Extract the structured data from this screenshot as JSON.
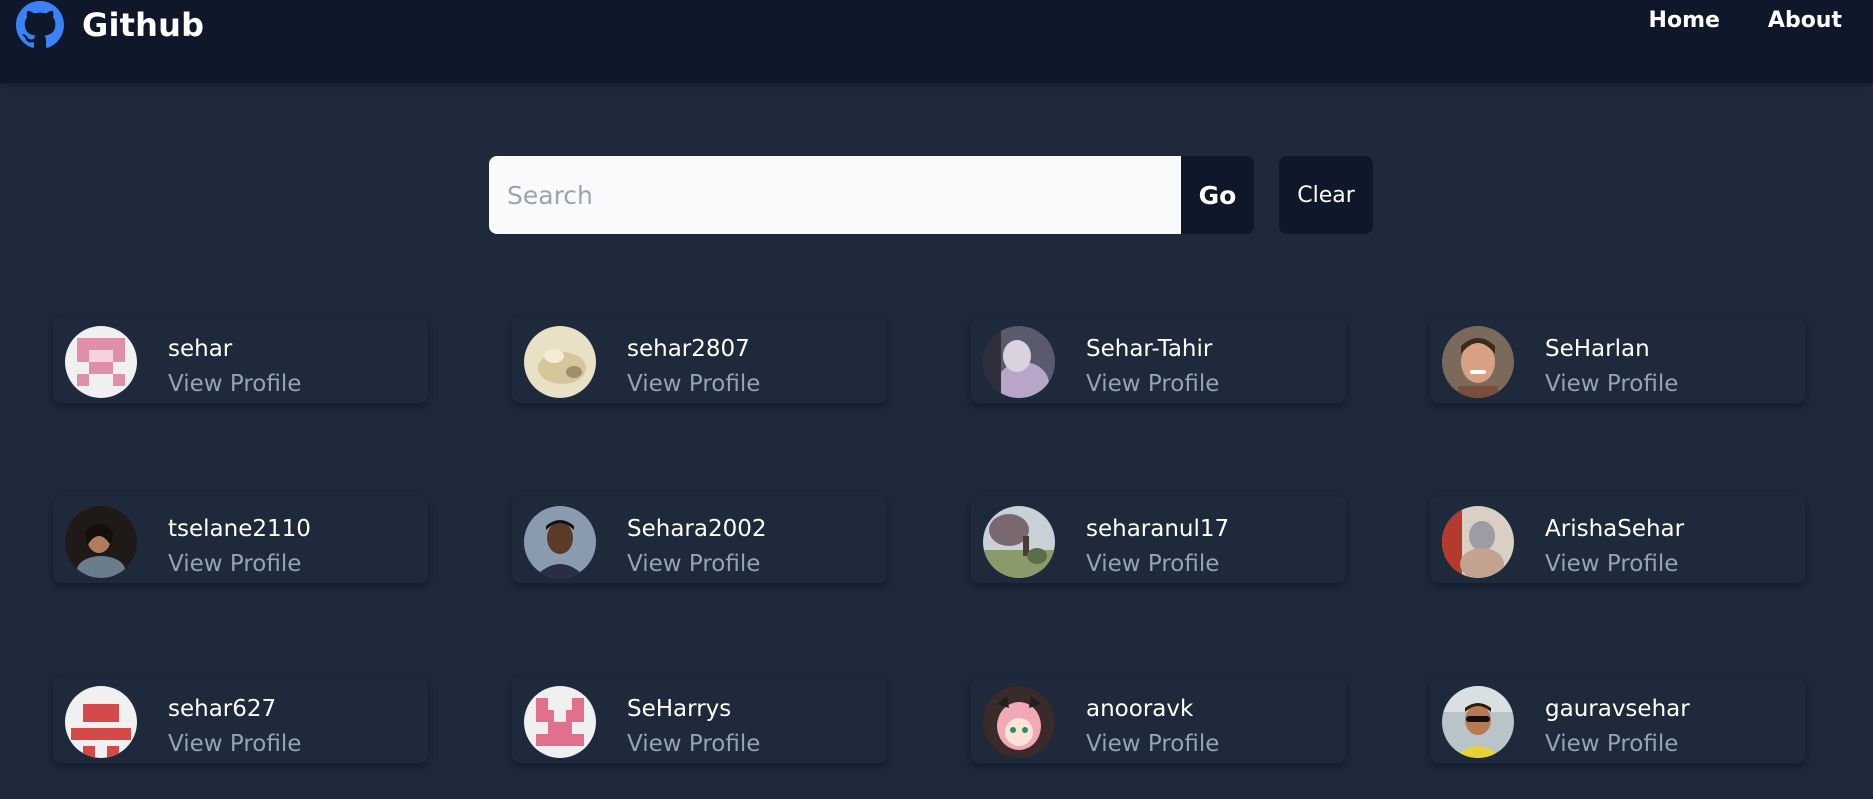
{
  "navbar": {
    "brand": "Github",
    "links": [
      {
        "label": "Home"
      },
      {
        "label": "About"
      }
    ]
  },
  "search": {
    "placeholder": "Search",
    "value": "",
    "go_label": "Go",
    "clear_label": "Clear"
  },
  "users": [
    {
      "login": "sehar",
      "link": "View Profile",
      "avatar": "identicon-pink"
    },
    {
      "login": "sehar2807",
      "link": "View Profile",
      "avatar": "photo-hands"
    },
    {
      "login": "Sehar-Tahir",
      "link": "View Profile",
      "avatar": "photo-hijab"
    },
    {
      "login": "SeHarlan",
      "link": "View Profile",
      "avatar": "photo-man-smiling"
    },
    {
      "login": "tselane2110",
      "link": "View Profile",
      "avatar": "photo-woman-glasses"
    },
    {
      "login": "Sehara2002",
      "link": "View Profile",
      "avatar": "photo-man-portrait"
    },
    {
      "login": "seharanul17",
      "link": "View Profile",
      "avatar": "photo-outdoor-tree"
    },
    {
      "login": "ArishaSehar",
      "link": "View Profile",
      "avatar": "photo-woman-hijab"
    },
    {
      "login": "sehar627",
      "link": "View Profile",
      "avatar": "identicon-red"
    },
    {
      "login": "SeHarrys",
      "link": "View Profile",
      "avatar": "identicon-pink-2"
    },
    {
      "login": "anooravk",
      "link": "View Profile",
      "avatar": "anime-pink-hair"
    },
    {
      "login": "gauravsehar",
      "link": "View Profile",
      "avatar": "photo-man-sunglasses"
    }
  ],
  "colors": {
    "page_bg": "#1e293b",
    "navbar_bg": "#0f172a",
    "button_bg": "#0f172a",
    "muted_text": "#94a3b8",
    "logo": "#3b82f6"
  }
}
